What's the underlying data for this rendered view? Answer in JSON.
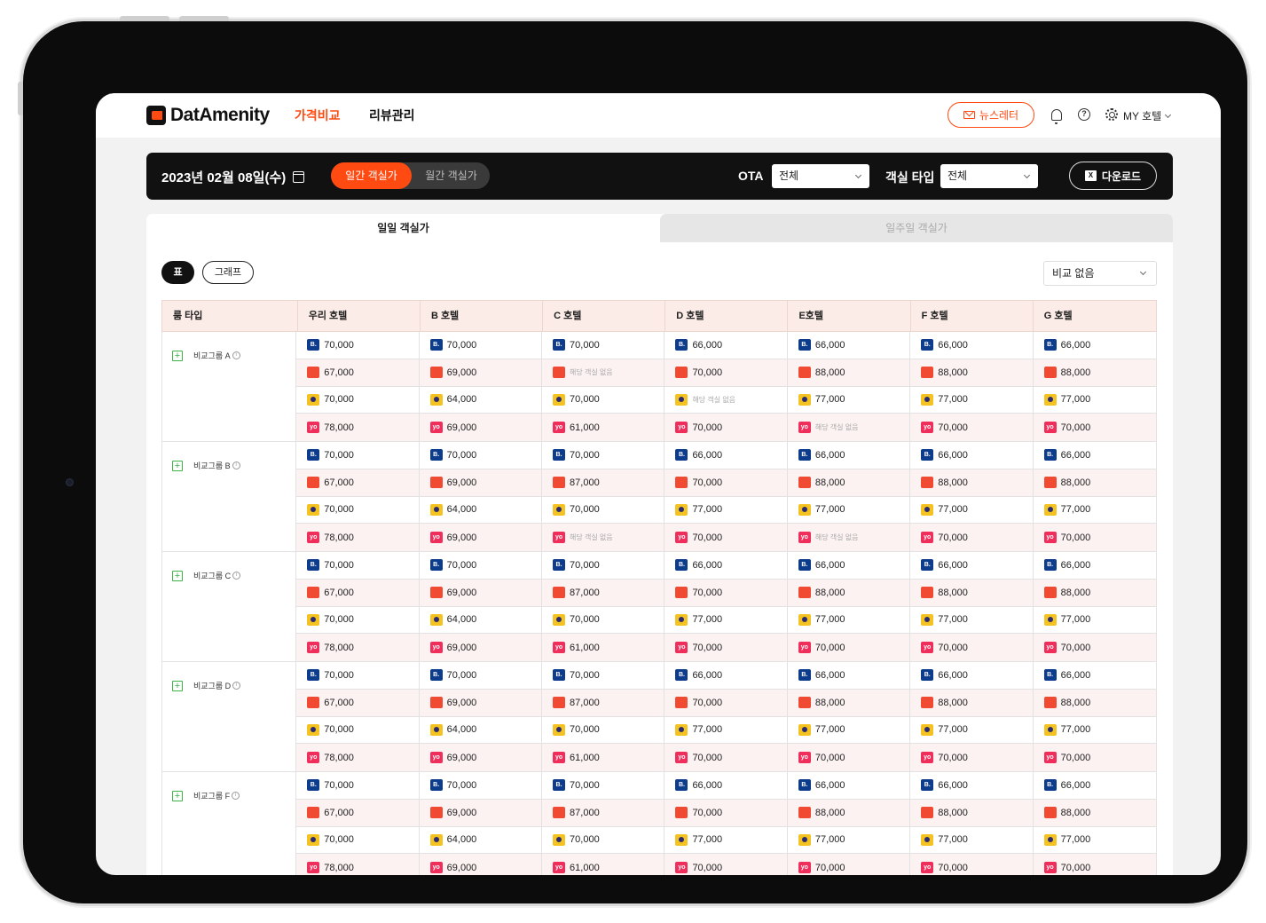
{
  "app": {
    "logo_text": "DatAmenity",
    "nav": [
      "가격비교",
      "리뷰관리"
    ],
    "newsletter": "뉴스레터",
    "user_menu": "MY 호텔"
  },
  "filters": {
    "date": "2023년 02월 08일(수)",
    "toggle": [
      "일간 객실가",
      "월간 객실가"
    ],
    "ota_label": "OTA",
    "ota_value": "전체",
    "room_label": "객실 타입",
    "room_value": "전체",
    "download": "다운로드"
  },
  "tabs": [
    "일일 객실가",
    "일주일 객실가"
  ],
  "view_buttons": [
    "표",
    "그래프"
  ],
  "compare_select": "비교 없음",
  "colors": {
    "accent": "#ff4a12",
    "booking": "#0e3c8c",
    "agoda": "#f04a32",
    "expedia": "#f4c321",
    "yanolja": "#ef2e5b"
  },
  "table": {
    "headers": [
      "룸 타입",
      "우리 호텔",
      "B 호텔",
      "C 호텔",
      "D 호텔",
      "E호텔",
      "F 호텔",
      "G 호텔"
    ],
    "groups": [
      {
        "name": "비교그룹 A",
        "rows": [
          {
            "ota": "booking",
            "values": [
              "70,000",
              "70,000",
              "70,000",
              "66,000",
              "66,000",
              "66,000",
              "66,000"
            ]
          },
          {
            "ota": "agoda",
            "values": [
              "67,000",
              "69,000",
              "해당 객실 없음",
              "70,000",
              "88,000",
              "88,000",
              "88,000"
            ]
          },
          {
            "ota": "expedia",
            "values": [
              "70,000",
              "64,000",
              "70,000",
              "해당 객실 없음",
              "77,000",
              "77,000",
              "77,000"
            ]
          },
          {
            "ota": "yanolja",
            "values": [
              "78,000",
              "69,000",
              "61,000",
              "70,000",
              "해당 객실 없음",
              "70,000",
              "70,000"
            ]
          }
        ]
      },
      {
        "name": "비교그룹 B",
        "rows": [
          {
            "ota": "booking",
            "values": [
              "70,000",
              "70,000",
              "70,000",
              "66,000",
              "66,000",
              "66,000",
              "66,000"
            ]
          },
          {
            "ota": "agoda",
            "values": [
              "67,000",
              "69,000",
              "87,000",
              "70,000",
              "88,000",
              "88,000",
              "88,000"
            ]
          },
          {
            "ota": "expedia",
            "values": [
              "70,000",
              "64,000",
              "70,000",
              "77,000",
              "77,000",
              "77,000",
              "77,000"
            ]
          },
          {
            "ota": "yanolja",
            "values": [
              "78,000",
              "69,000",
              "해당 객실 없음",
              "70,000",
              "해당 객실 없음",
              "70,000",
              "70,000"
            ]
          }
        ]
      },
      {
        "name": "비교그룹 C",
        "rows": [
          {
            "ota": "booking",
            "values": [
              "70,000",
              "70,000",
              "70,000",
              "66,000",
              "66,000",
              "66,000",
              "66,000"
            ]
          },
          {
            "ota": "agoda",
            "values": [
              "67,000",
              "69,000",
              "87,000",
              "70,000",
              "88,000",
              "88,000",
              "88,000"
            ]
          },
          {
            "ota": "expedia",
            "values": [
              "70,000",
              "64,000",
              "70,000",
              "77,000",
              "77,000",
              "77,000",
              "77,000"
            ]
          },
          {
            "ota": "yanolja",
            "values": [
              "78,000",
              "69,000",
              "61,000",
              "70,000",
              "70,000",
              "70,000",
              "70,000"
            ]
          }
        ]
      },
      {
        "name": "비교그룹 D",
        "rows": [
          {
            "ota": "booking",
            "values": [
              "70,000",
              "70,000",
              "70,000",
              "66,000",
              "66,000",
              "66,000",
              "66,000"
            ]
          },
          {
            "ota": "agoda",
            "values": [
              "67,000",
              "69,000",
              "87,000",
              "70,000",
              "88,000",
              "88,000",
              "88,000"
            ]
          },
          {
            "ota": "expedia",
            "values": [
              "70,000",
              "64,000",
              "70,000",
              "77,000",
              "77,000",
              "77,000",
              "77,000"
            ]
          },
          {
            "ota": "yanolja",
            "values": [
              "78,000",
              "69,000",
              "61,000",
              "70,000",
              "70,000",
              "70,000",
              "70,000"
            ]
          }
        ]
      },
      {
        "name": "비교그룹 F",
        "rows": [
          {
            "ota": "booking",
            "values": [
              "70,000",
              "70,000",
              "70,000",
              "66,000",
              "66,000",
              "66,000",
              "66,000"
            ]
          },
          {
            "ota": "agoda",
            "values": [
              "67,000",
              "69,000",
              "87,000",
              "70,000",
              "88,000",
              "88,000",
              "88,000"
            ]
          },
          {
            "ota": "expedia",
            "values": [
              "70,000",
              "64,000",
              "70,000",
              "77,000",
              "77,000",
              "77,000",
              "77,000"
            ]
          },
          {
            "ota": "yanolja",
            "values": [
              "78,000",
              "69,000",
              "61,000",
              "70,000",
              "70,000",
              "70,000",
              "70,000"
            ]
          }
        ]
      }
    ]
  }
}
